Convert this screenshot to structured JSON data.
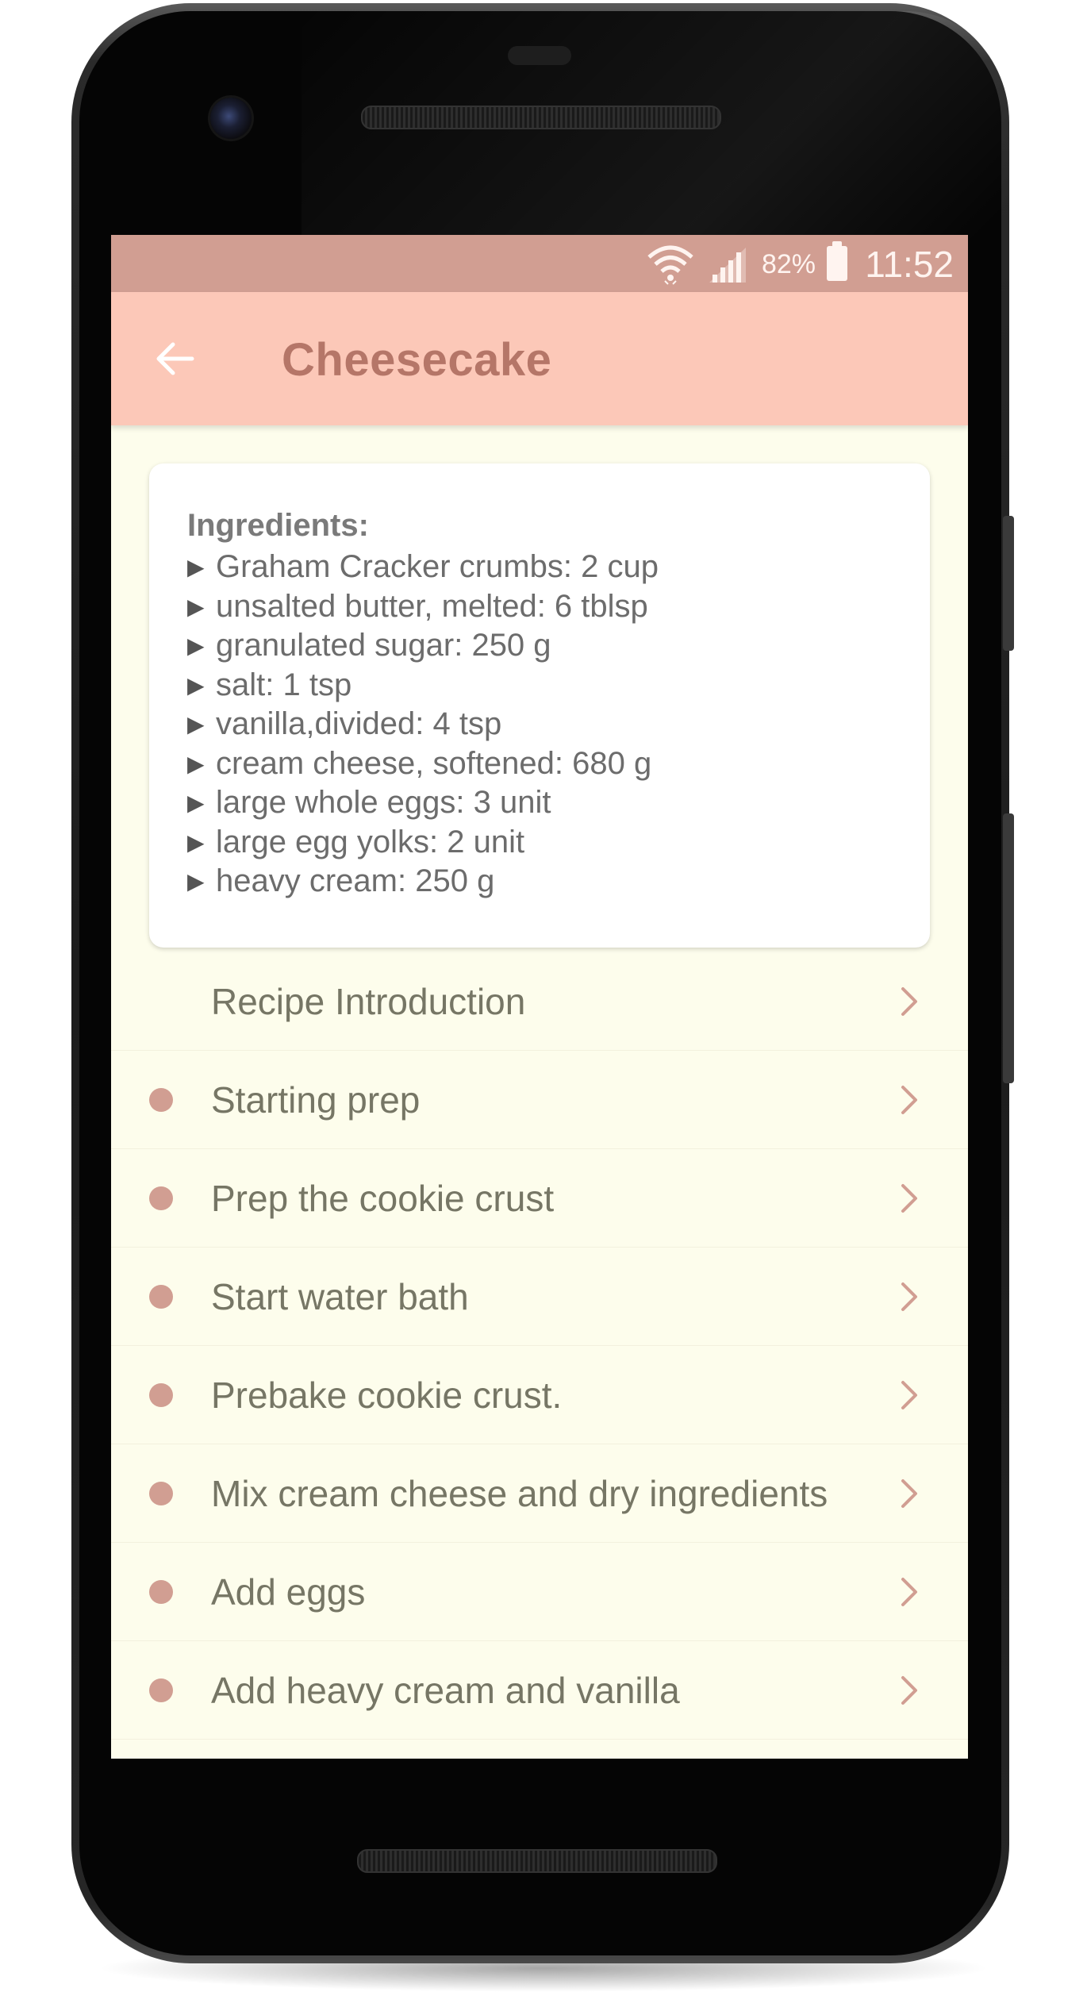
{
  "status_bar": {
    "battery_percent": "82%",
    "time": "11:52"
  },
  "app_bar": {
    "title": "Cheesecake"
  },
  "ingredients": {
    "heading": "Ingredients:",
    "items": [
      "Graham Cracker crumbs: 2 cup",
      "unsalted butter, melted: 6 tblsp",
      "granulated sugar: 250 g",
      "salt: 1 tsp",
      "vanilla,divided: 4 tsp",
      "cream cheese, softened: 680 g",
      "large whole eggs: 3 unit",
      "large egg yolks: 2 unit",
      "heavy cream: 250 g"
    ]
  },
  "steps": [
    {
      "label": "Recipe Introduction",
      "bullet": false
    },
    {
      "label": "Starting prep",
      "bullet": true
    },
    {
      "label": "Prep the cookie crust",
      "bullet": true
    },
    {
      "label": "Start water bath",
      "bullet": true
    },
    {
      "label": "Prebake cookie crust.",
      "bullet": true
    },
    {
      "label": "Mix cream cheese and dry ingredients",
      "bullet": true
    },
    {
      "label": "Add eggs",
      "bullet": true
    },
    {
      "label": "Add heavy cream and vanilla",
      "bullet": true
    }
  ],
  "colors": {
    "status_bar": "#d19e92",
    "app_bar": "#fcc8b8",
    "title_text": "#b57668",
    "background": "#fdfdec",
    "bullet": "#d19e92"
  }
}
